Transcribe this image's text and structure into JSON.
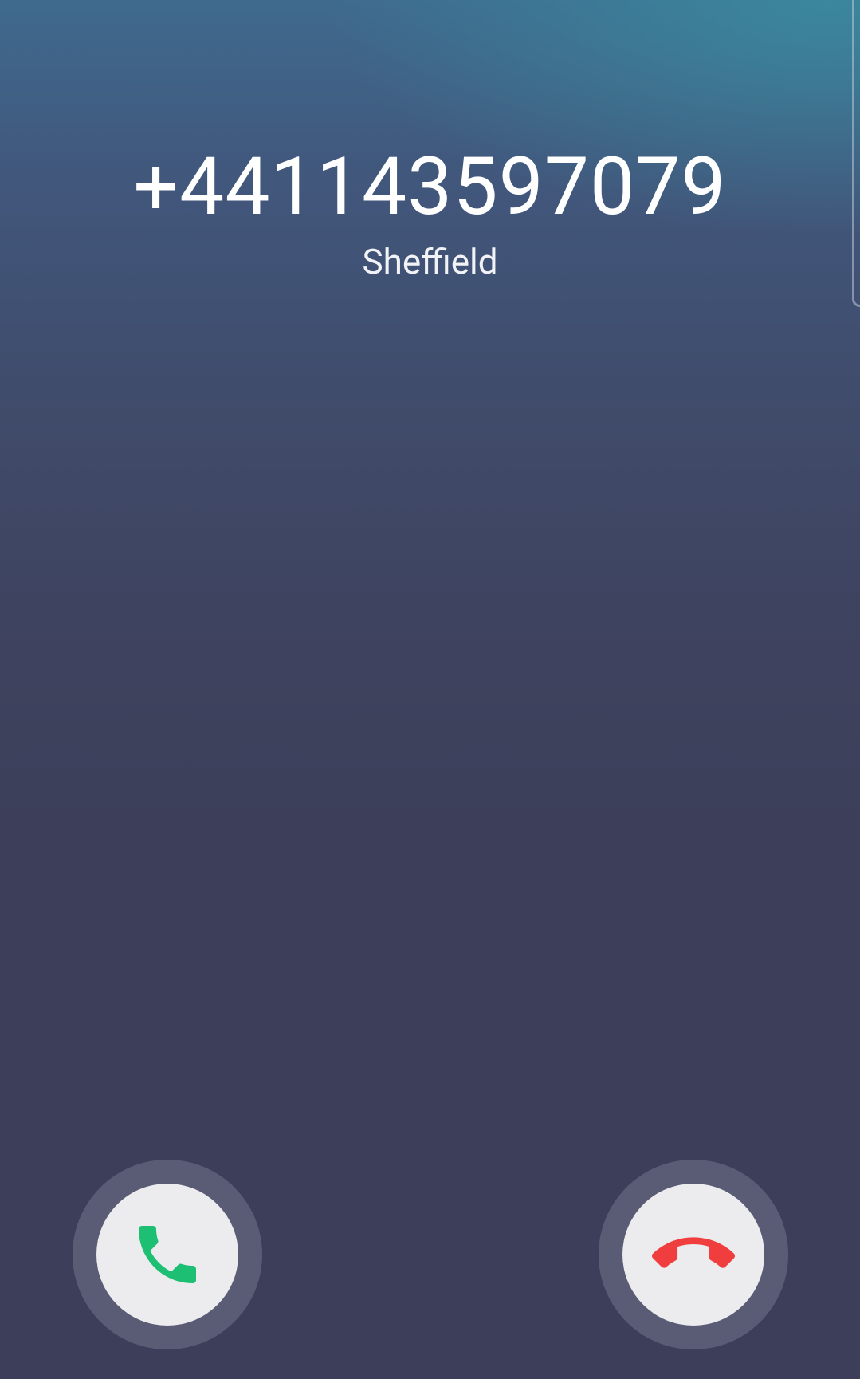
{
  "caller": {
    "number": "+441143597079",
    "location": "Sheffield"
  },
  "actions": {
    "answer_icon": "phone-answer-icon",
    "decline_icon": "phone-decline-icon"
  },
  "colors": {
    "answer": "#1dbf73",
    "decline": "#f03e3e",
    "button_face": "#ececef",
    "background_top": "#3f6a8e",
    "background_bottom": "#3d3f5a"
  }
}
